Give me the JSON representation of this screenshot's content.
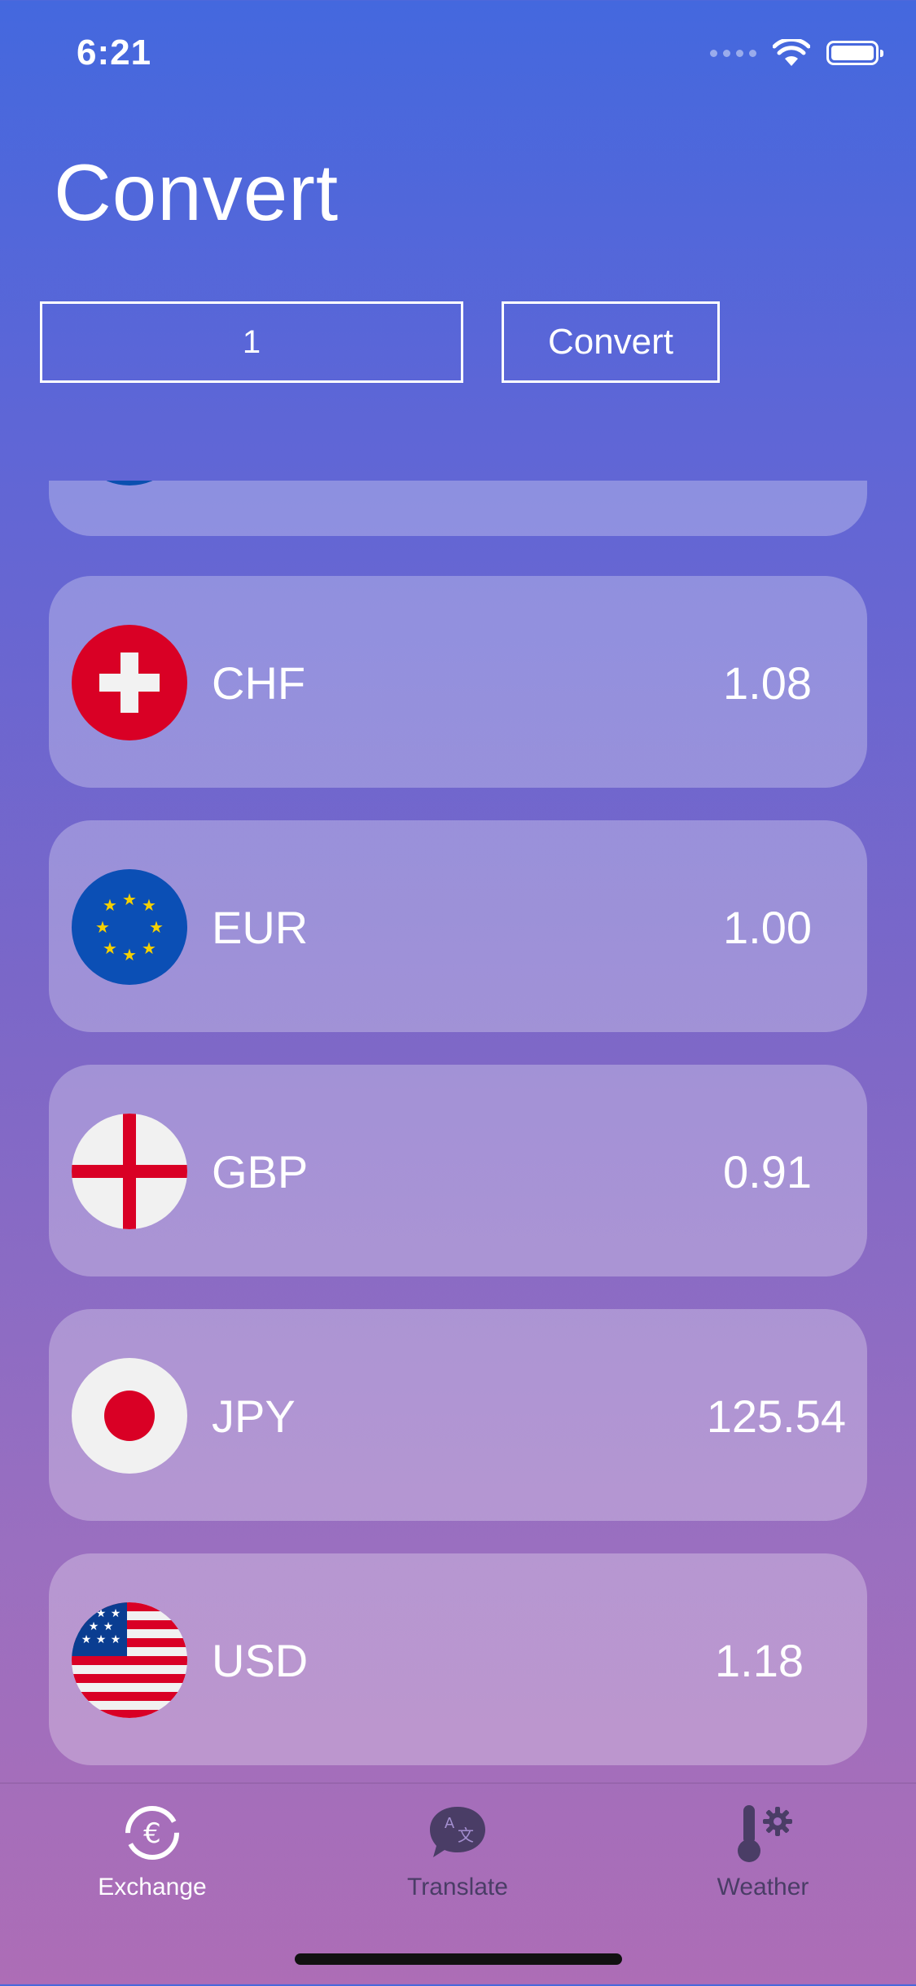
{
  "status_bar": {
    "time": "6:21"
  },
  "header": {
    "title": "Convert"
  },
  "converter": {
    "amount_value": "1",
    "convert_label": "Convert"
  },
  "currencies": [
    {
      "code": "",
      "rate": "",
      "flag_icon": "blue-flag-icon"
    },
    {
      "code": "CHF",
      "rate": "1.08",
      "flag_icon": "swiss-flag-icon"
    },
    {
      "code": "EUR",
      "rate": "1.00",
      "flag_icon": "eu-flag-icon"
    },
    {
      "code": "GBP",
      "rate": "0.91",
      "flag_icon": "england-flag-icon"
    },
    {
      "code": "JPY",
      "rate": "125.54",
      "flag_icon": "japan-flag-icon"
    },
    {
      "code": "USD",
      "rate": "1.18",
      "flag_icon": "usa-flag-icon"
    }
  ],
  "tab_bar": {
    "tabs": [
      {
        "label": "Exchange",
        "icon": "exchange-icon",
        "active": true
      },
      {
        "label": "Translate",
        "icon": "translate-icon",
        "active": false
      },
      {
        "label": "Weather",
        "icon": "weather-icon",
        "active": false
      }
    ]
  },
  "colors": {
    "gradient_top": "#4468de",
    "gradient_bottom": "#ad6db6",
    "card": "rgba(255,255,255,0.28)"
  }
}
